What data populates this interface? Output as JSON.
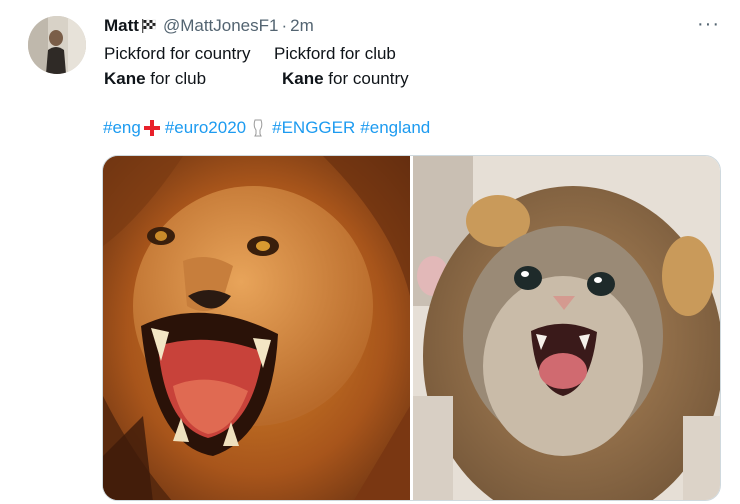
{
  "tweet": {
    "author_name": "Matt",
    "handle": "@MattJonesF1",
    "separator": "·",
    "time": "2m",
    "more_label": "···",
    "line1_part1": "Pickford for country",
    "line1_part2": "Pickford for club",
    "line2_bold1": "Kane",
    "line2_rest1": " for club",
    "line2_bold2": "Kane",
    "line2_rest2": " for country",
    "hashtags": [
      "#eng",
      "#euro2020",
      "#ENGGER",
      "#england"
    ]
  },
  "icons": {
    "flag": "chequered-flag-icon",
    "eng_flag": "england-flag-icon",
    "trophy": "trophy-icon",
    "more": "more-options-icon"
  },
  "colors": {
    "link": "#1d9bf0",
    "secondary_text": "#536471",
    "primary_text": "#0f1419"
  }
}
